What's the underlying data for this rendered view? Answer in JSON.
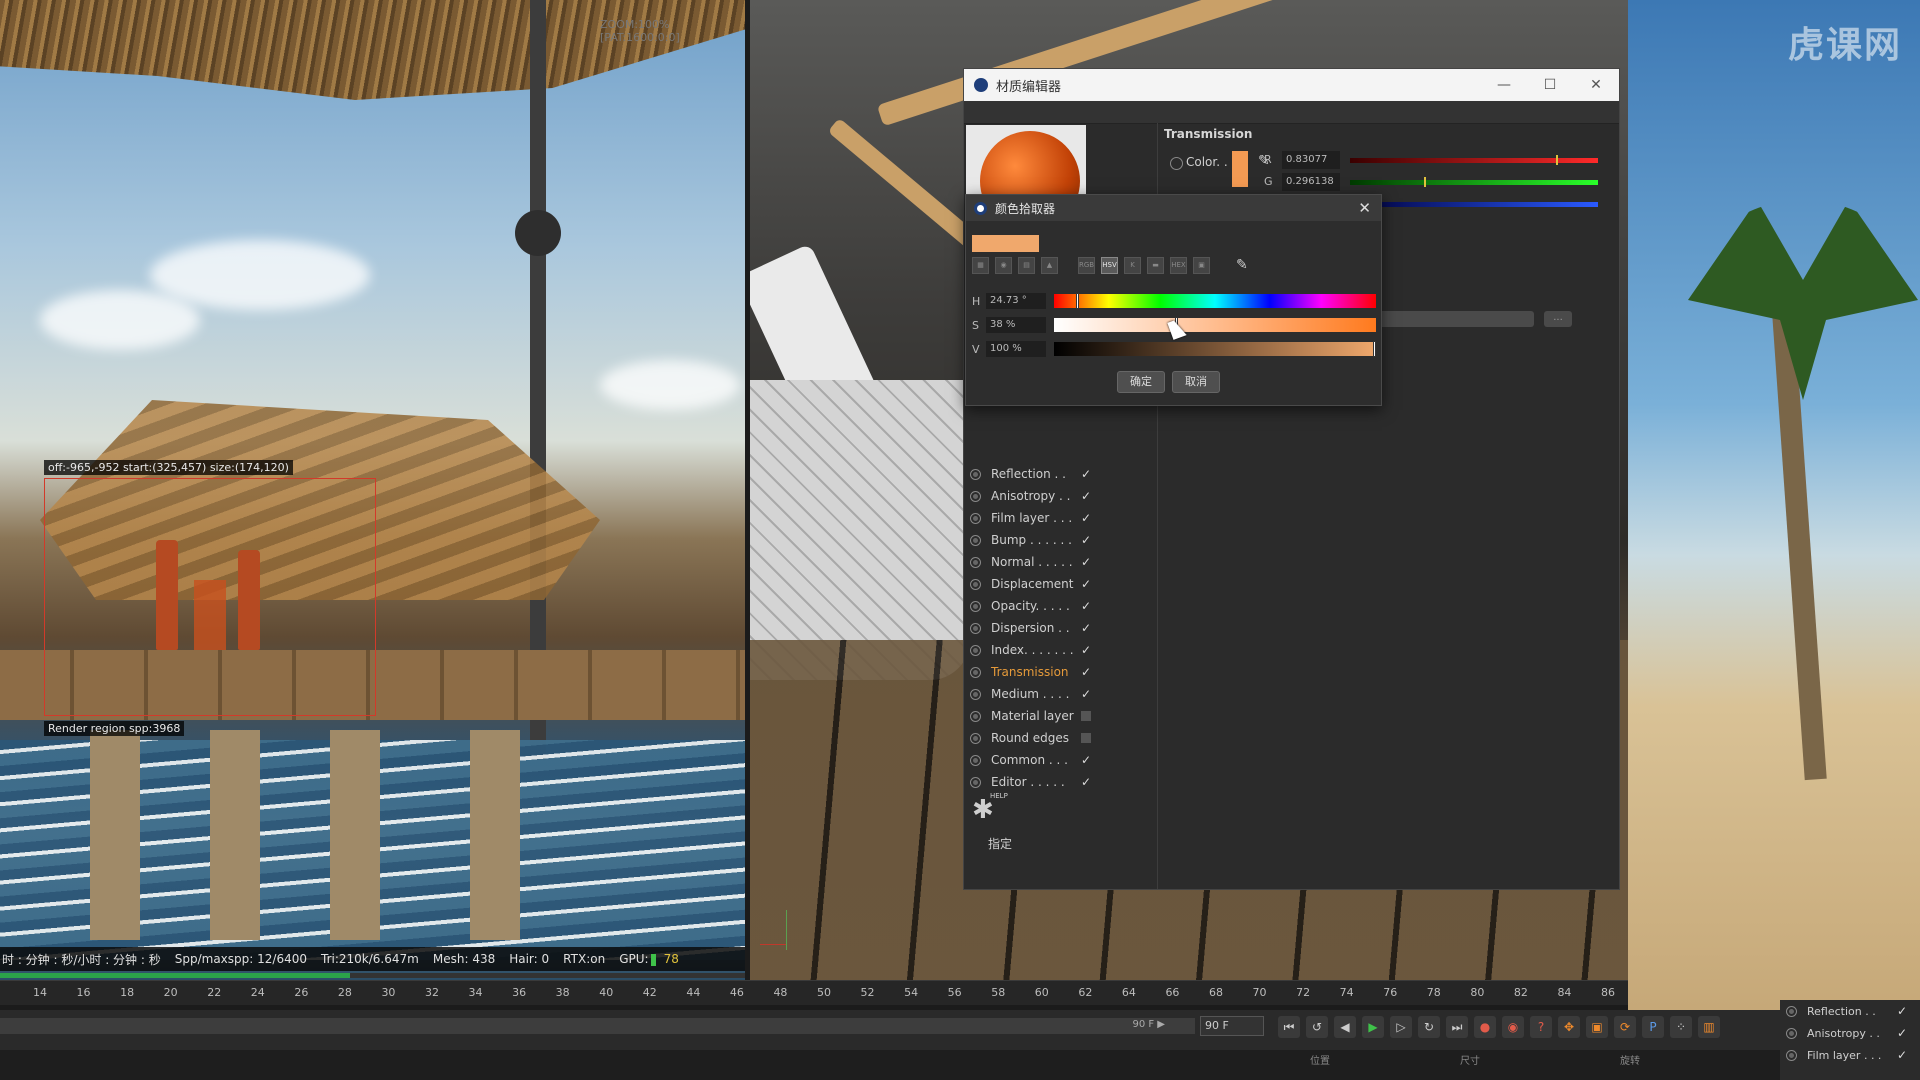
{
  "watermark": "虎课网",
  "render_view": {
    "zoom_text": "ZOOM:100% [PAT:1600:0:0]",
    "region_label": "off:-965,-952 start:(325,457) size:(174,120)",
    "spp_label": "Render region spp:3968",
    "status": {
      "time_label": "时 : 分钟 : 秒/小时 : 分钟 : 秒",
      "spp_label": "Spp/maxspp:",
      "spp_value": "12/6400",
      "tri_label": "Tri:",
      "tri_value": "210k/6.647m",
      "mesh_label": "Mesh:",
      "mesh_value": "438",
      "hair_label": "Hair:",
      "hair_value": "0",
      "rtx_label": "RTX:",
      "rtx_value": "on",
      "gpu_label": "GPU:",
      "gpu_value": "78"
    },
    "progress_fraction": 0.47
  },
  "material_editor": {
    "title": "材质编辑器",
    "window_buttons": [
      "—",
      "☐",
      "✕"
    ],
    "section_title": "Transmission",
    "color_label": "Color. .",
    "swatch_color": "#f39a53",
    "channels": [
      {
        "ch": "R",
        "value": "0.83077",
        "marker_fraction": 0.83
      },
      {
        "ch": "G",
        "value": "0.296138",
        "marker_fraction": 0.3
      },
      {
        "ch": "B",
        "value": "",
        "marker_fraction": 0.08
      }
    ],
    "more_button": "...",
    "channel_list": [
      {
        "label": "Reflection . .",
        "state": "✓",
        "active": false
      },
      {
        "label": "Anisotropy . .",
        "state": "✓",
        "active": false
      },
      {
        "label": "Film layer . . .",
        "state": "✓",
        "active": false
      },
      {
        "label": "Bump . . . . . .",
        "state": "✓",
        "active": false
      },
      {
        "label": "Normal . . . . .",
        "state": "✓",
        "active": false
      },
      {
        "label": "Displacement",
        "state": "✓",
        "active": false
      },
      {
        "label": "Opacity. . . . .",
        "state": "✓",
        "active": false
      },
      {
        "label": "Dispersion . .",
        "state": "✓",
        "active": false
      },
      {
        "label": "Index. . . . . . .",
        "state": "✓",
        "active": false
      },
      {
        "label": "Transmission",
        "state": "✓",
        "active": true
      },
      {
        "label": "Medium . . . .",
        "state": "✓",
        "active": false
      },
      {
        "label": "Material layer",
        "state": "",
        "active": false
      },
      {
        "label": "Round edges",
        "state": "",
        "active": false
      },
      {
        "label": "Common . . .",
        "state": "✓",
        "active": false
      },
      {
        "label": "Editor . . . . .",
        "state": "✓",
        "active": false
      }
    ],
    "help_text": "HELP",
    "assign_label": "指定"
  },
  "color_picker": {
    "title": "颜色拾取器",
    "swatch_color": "#f0a86c",
    "tools": [
      "▦",
      "◉",
      "▤",
      "▲",
      "RGB",
      "HSV",
      "K",
      "▬",
      "HEX",
      "▣"
    ],
    "active_tool": "HSV",
    "rows": [
      {
        "key": "H",
        "value": "24.73 °",
        "fraction": 0.07
      },
      {
        "key": "S",
        "value": "38 %",
        "fraction": 0.38
      },
      {
        "key": "V",
        "value": "100 %",
        "fraction": 1.0
      }
    ],
    "ok_label": "确定",
    "cancel_label": "取消"
  },
  "timeline": {
    "ticks": [
      "14",
      "16",
      "18",
      "20",
      "22",
      "24",
      "26",
      "28",
      "30",
      "32",
      "34",
      "36",
      "38",
      "40",
      "42",
      "44",
      "46",
      "48",
      "50",
      "52",
      "54",
      "56",
      "58",
      "60",
      "62",
      "64",
      "66",
      "68",
      "70",
      "72",
      "74",
      "76",
      "78",
      "80",
      "82",
      "84",
      "86"
    ],
    "end_frame_label": "90 F ▶",
    "frame_field": "90 F",
    "bottom_labels": [
      "位置",
      "尺寸",
      "旋转"
    ]
  },
  "corner_panel": {
    "items": [
      {
        "label": "Reflection . .",
        "state": "✓"
      },
      {
        "label": "Anisotropy . .",
        "state": "✓"
      },
      {
        "label": "Film layer . . .",
        "state": "✓"
      }
    ]
  }
}
